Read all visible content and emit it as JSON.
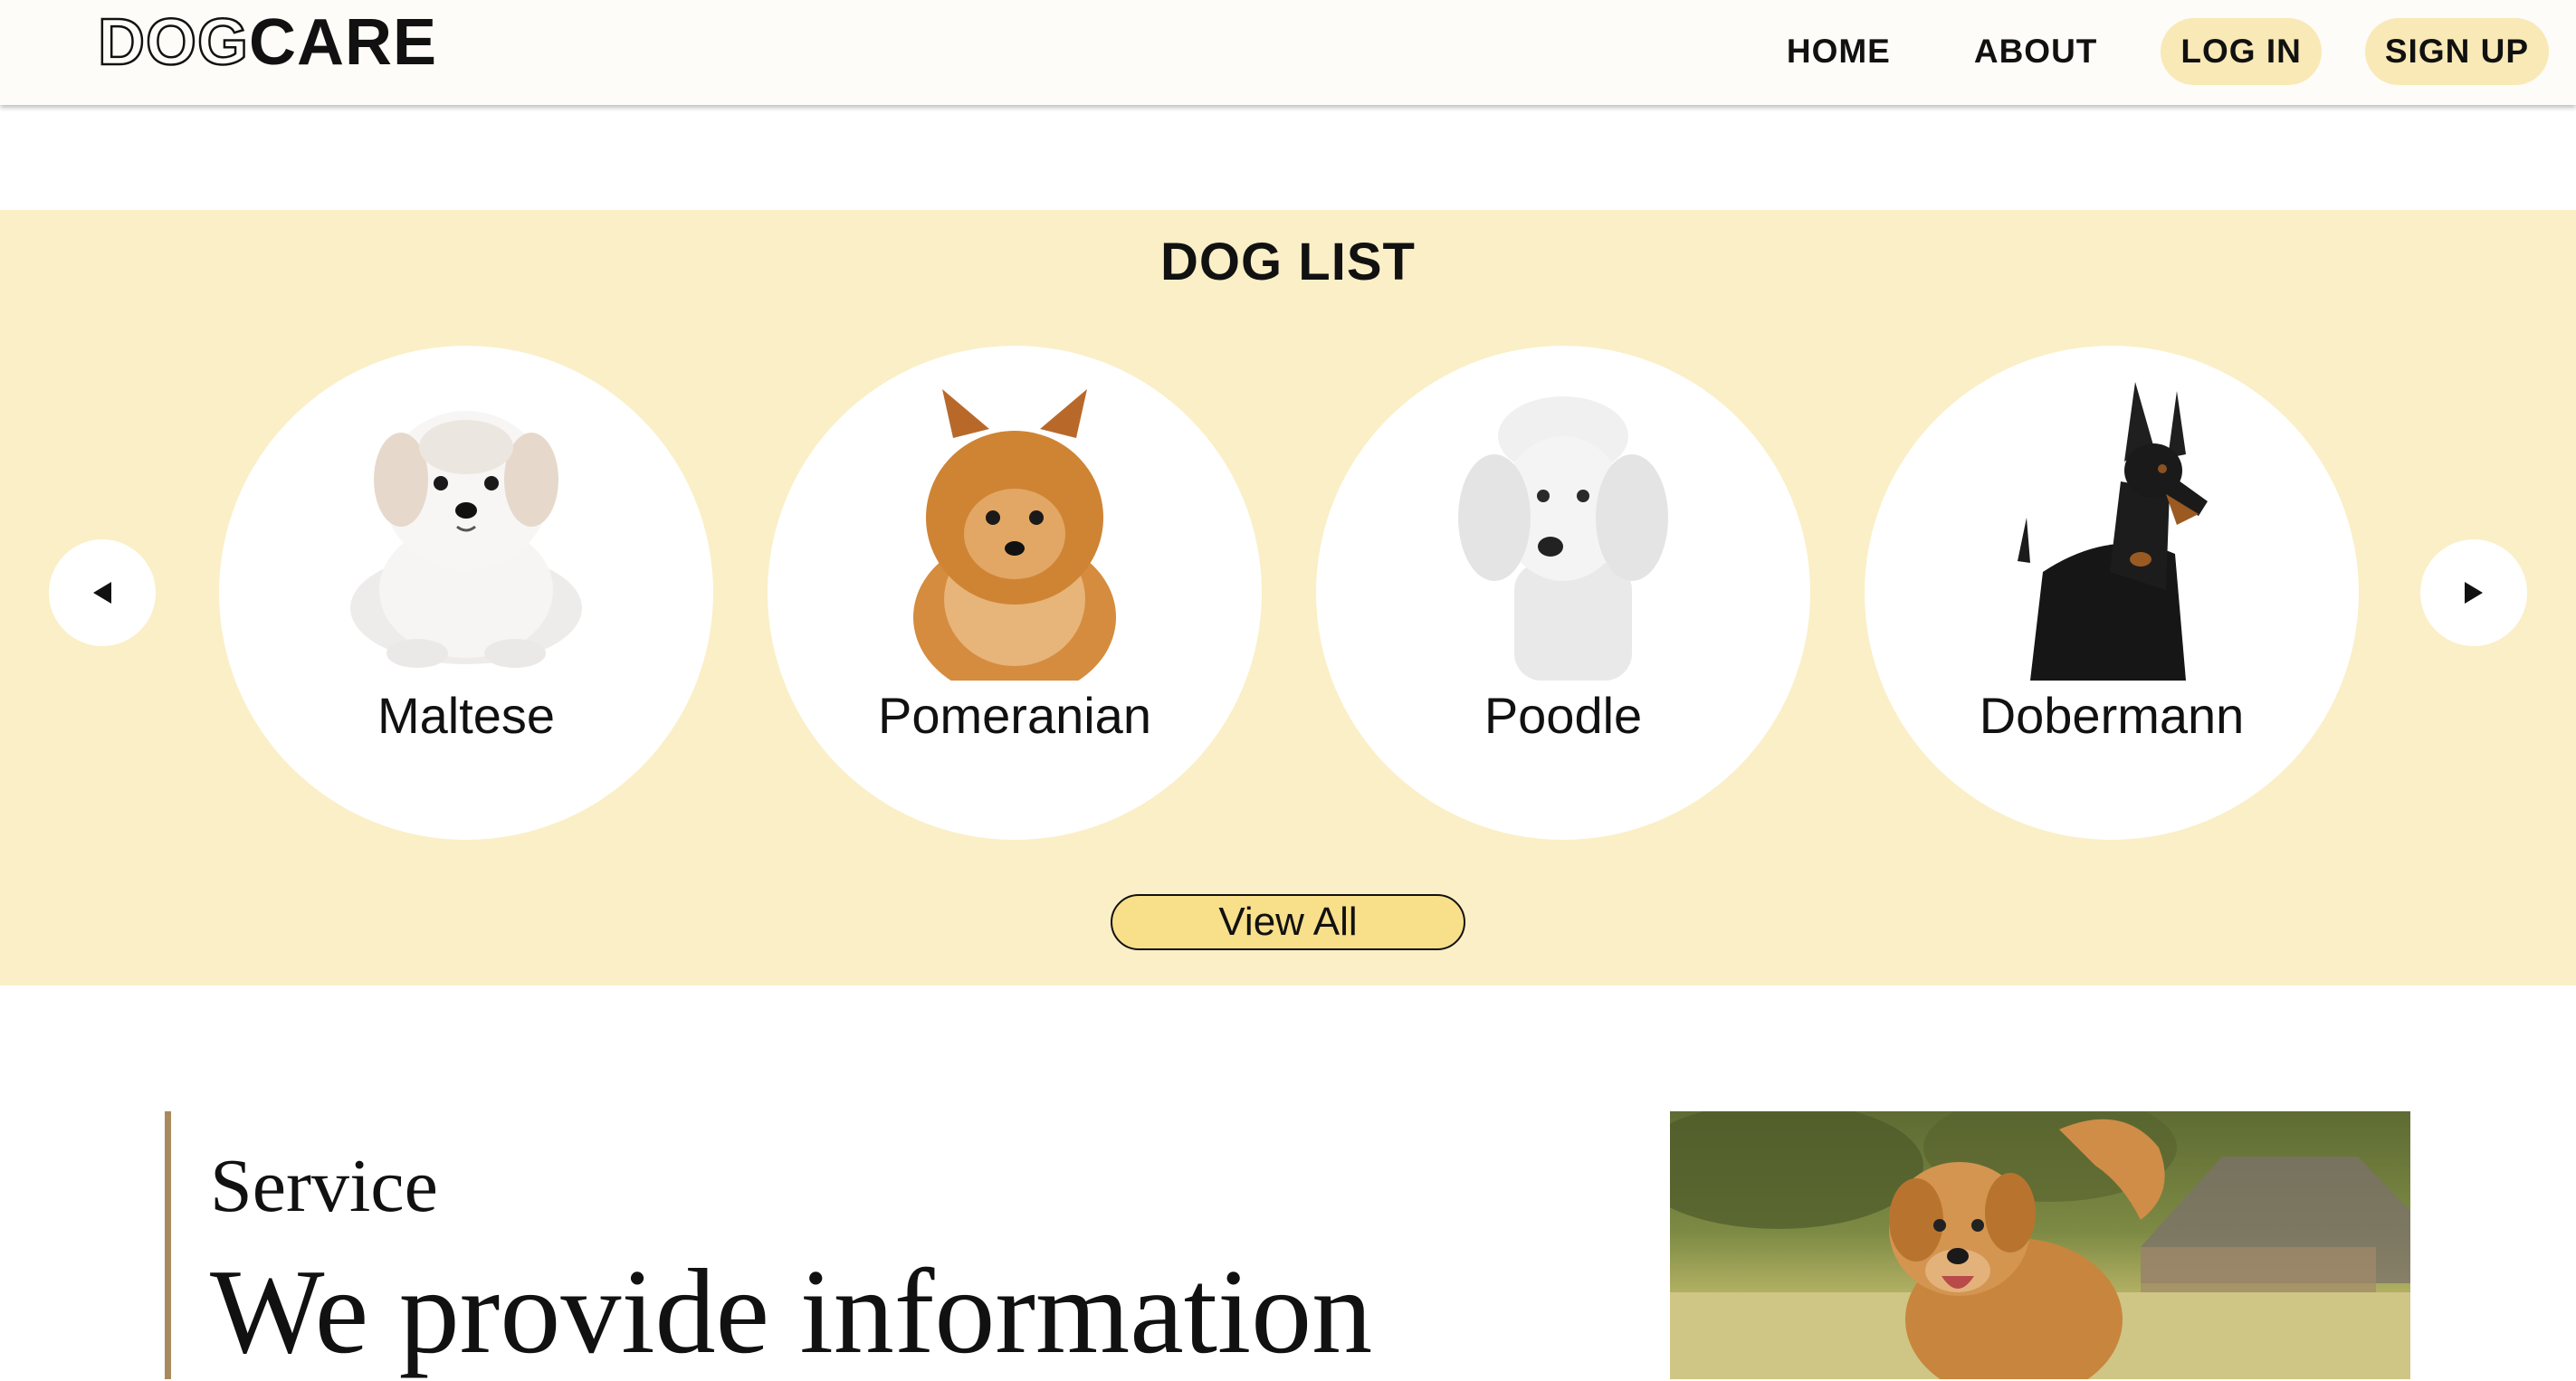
{
  "header": {
    "logo_outline": "DOG",
    "logo_solid": "CARE",
    "nav": {
      "home": "HOME",
      "about": "ABOUT",
      "login": "LOG IN",
      "signup": "SIGN UP"
    }
  },
  "dog_list": {
    "title": "DOG LIST",
    "prev_icon": "triangle-left-icon",
    "next_icon": "triangle-right-icon",
    "dogs": [
      {
        "name": "Maltese",
        "image": "maltese-photo"
      },
      {
        "name": "Pomeranian",
        "image": "pomeranian-photo"
      },
      {
        "name": "Poodle",
        "image": "poodle-photo"
      },
      {
        "name": "Dobermann",
        "image": "dobermann-photo"
      }
    ],
    "view_all": "View All"
  },
  "service": {
    "label": "Service",
    "heading": "We provide information",
    "image": "golden-retriever-photo"
  },
  "colors": {
    "header_bg": "#fdfcf8",
    "pill_bg": "#f9e9b6",
    "section_bg": "#faefc6",
    "button_bg": "#f8df8a",
    "accent_bar": "#a98a5e"
  }
}
